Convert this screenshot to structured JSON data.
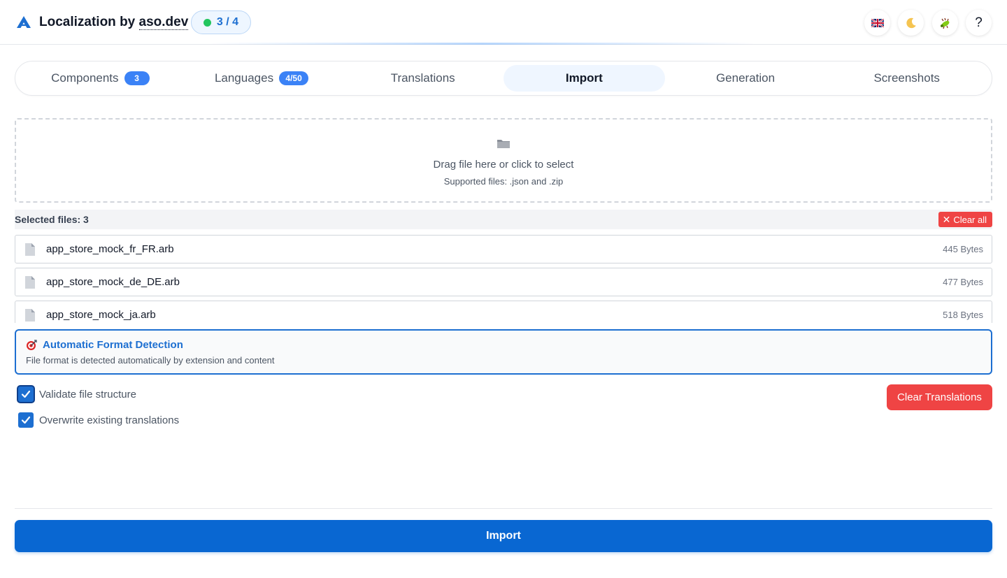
{
  "header": {
    "brand_prefix": "Localization by ",
    "brand_link": "aso.dev",
    "progress": "3 / 4",
    "language_icon": "uk-flag-icon",
    "theme_icon": "moon-icon",
    "bug_icon": "bug-icon",
    "help_label": "?"
  },
  "tabs": [
    {
      "label": "Components",
      "badge": "3"
    },
    {
      "label": "Languages",
      "badge": "4/50"
    },
    {
      "label": "Translations"
    },
    {
      "label": "Import",
      "active": true
    },
    {
      "label": "Generation"
    },
    {
      "label": "Screenshots"
    }
  ],
  "dropzone": {
    "icon": "folder-icon",
    "title": "Drag file here or click to select",
    "subtitle": "Supported files: .json and .zip"
  },
  "files": {
    "count_label": "Selected files: 3",
    "clear_all_label": "Clear all",
    "items": [
      {
        "name": "app_store_mock_fr_FR.arb",
        "size": "445 Bytes"
      },
      {
        "name": "app_store_mock_de_DE.arb",
        "size": "477 Bytes"
      },
      {
        "name": "app_store_mock_ja.arb",
        "size": "518 Bytes"
      }
    ]
  },
  "auto_detect": {
    "icon": "target-icon",
    "title": "Automatic Format Detection",
    "description": "File format is detected automatically by extension and content"
  },
  "options": {
    "validate_label": "Validate file structure",
    "validate_checked": true,
    "overwrite_label": "Overwrite existing translations",
    "overwrite_checked": true
  },
  "actions": {
    "clear_translations_label": "Clear Translations",
    "import_label": "Import"
  },
  "colors": {
    "primary": "#0967d2",
    "danger": "#ef4444",
    "success": "#22c55e"
  }
}
